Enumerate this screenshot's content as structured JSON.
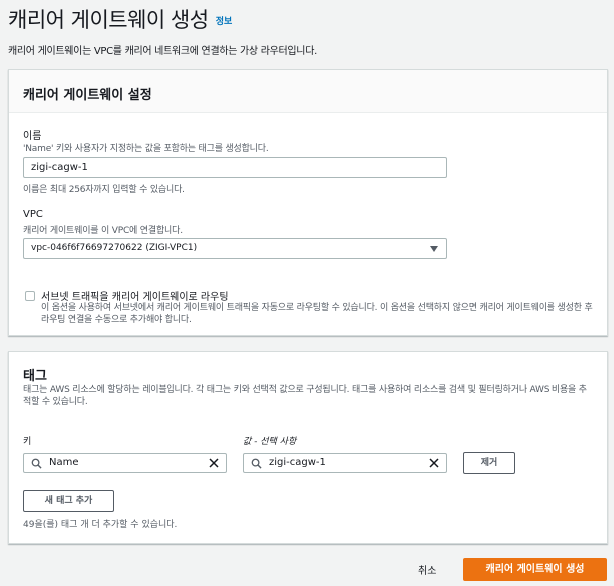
{
  "page": {
    "title": "캐리어 게이트웨이 생성",
    "info_link": "정보",
    "description": "캐리어 게이트웨이는 VPC를 캐리어 네트워크에 연결하는 가상 라우터입니다."
  },
  "settings": {
    "title": "캐리어 게이트웨이 설정",
    "name_label": "이름",
    "name_desc": "'Name' 키와 사용자가 지정하는 값을 포함하는 태그를 생성합니다.",
    "name_value": "zigi-cagw-1",
    "name_hint": "이름은 최대 256자까지 입력할 수 있습니다.",
    "vpc_label": "VPC",
    "vpc_desc": "캐리어 게이트웨이를 이 VPC에 연결합니다.",
    "vpc_selected": "vpc-046f6f76697270622 (ZIGI-VPC1)",
    "route_label": "서브넷 트래픽을 캐리어 게이트웨이로 라우팅",
    "route_desc": "이 옵션을 사용하여 서브넷에서 캐리어 게이트웨이 트래픽을 자동으로 라우팅할 수 있습니다. 이 옵션을 선택하지 않으면 캐리어 게이트웨이를 생성한 후 라우팅 연결을 수동으로 추가해야 합니다."
  },
  "tags": {
    "title": "태그",
    "description": "태그는 AWS 리소스에 할당하는 레이블입니다. 각 태그는 키와 선택적 값으로 구성됩니다. 태그를 사용하여 리소스를 검색 및 필터링하거나 AWS 비용을 추적할 수 있습니다.",
    "key_label": "키",
    "value_label": "값 - 선택 사항",
    "key_value": "Name",
    "value_value": "zigi-cagw-1",
    "remove_label": "제거",
    "add_label": "새 태그 추가",
    "hint": "49을(를) 태그 개 더 추가할 수 있습니다."
  },
  "footer": {
    "cancel_label": "취소",
    "create_label": "캐리어 게이트웨이 생성"
  },
  "colors": {
    "primary": "#ec7211",
    "link": "#0073bb",
    "background": "#f2f3f3"
  }
}
